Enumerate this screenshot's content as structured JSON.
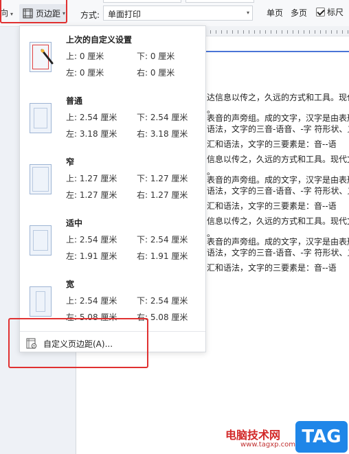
{
  "toolbar": {
    "orientation_label": "向",
    "margin_label": "页边距",
    "method_label": "方式:",
    "method_value": "单面打印",
    "single_page": "单页",
    "multi_page": "多页",
    "ruler_label": "标尺",
    "ruler_checked": true
  },
  "dropdown": {
    "presets": [
      {
        "title": "上次的自定义设置",
        "top": "上: 0 厘米",
        "bottom": "下: 0 厘米",
        "left": "左: 0 厘米",
        "right": "右: 0 厘米",
        "icon": "custom-margin-icon"
      },
      {
        "title": "普通",
        "top": "上: 2.54 厘米",
        "bottom": "下: 2.54 厘米",
        "left": "左: 3.18 厘米",
        "right": "右: 3.18 厘米",
        "icon": "normal-margin-icon"
      },
      {
        "title": "窄",
        "top": "上: 1.27 厘米",
        "bottom": "下: 1.27 厘米",
        "left": "左: 1.27 厘米",
        "right": "右: 1.27 厘米",
        "icon": "narrow-margin-icon"
      },
      {
        "title": "适中",
        "top": "上: 2.54 厘米",
        "bottom": "下: 2.54 厘米",
        "left": "左: 1.91 厘米",
        "right": "右: 1.91 厘米",
        "icon": "moderate-margin-icon"
      },
      {
        "title": "宽",
        "top": "上: 2.54 厘米",
        "bottom": "下: 2.54 厘米",
        "left": "左: 5.08 厘米",
        "right": "右: 5.08 厘米",
        "icon": "wide-margin-icon"
      }
    ],
    "custom_label": "自定义页边距(A)..."
  },
  "document": {
    "lines": [
      "达信息以传之，久远的方式和工具。现代",
      "。",
      "表音的声旁组。成的文字，汉字是由表形",
      "语法，文字的三音-语音、-字 符形状、义",
      "汇和语法，文字的三要素是：音--语",
      "信息以传之，久远的方式和工具。现代文",
      "。",
      "表音的声旁组。成的文字，汉字是由表形",
      "语法，文字的三音-语音、-字 符形状、义",
      "汇和语法，文字的三要素是：音--语",
      "信息以传之，久远的方式和工具。现代文",
      "。",
      "表音的声旁组。成的文字，汉字是由表形",
      "语法，文字的三音-语音、-字 符形状、义",
      "汇和语法，文字的三要素是：音--语"
    ]
  },
  "watermark": {
    "text": "电脑技术网",
    "url": "www.tagxp.com",
    "badge": "TAG"
  },
  "colors": {
    "highlight": "#e03030",
    "accent": "#4a74d6",
    "badge": "#1f86e8"
  }
}
